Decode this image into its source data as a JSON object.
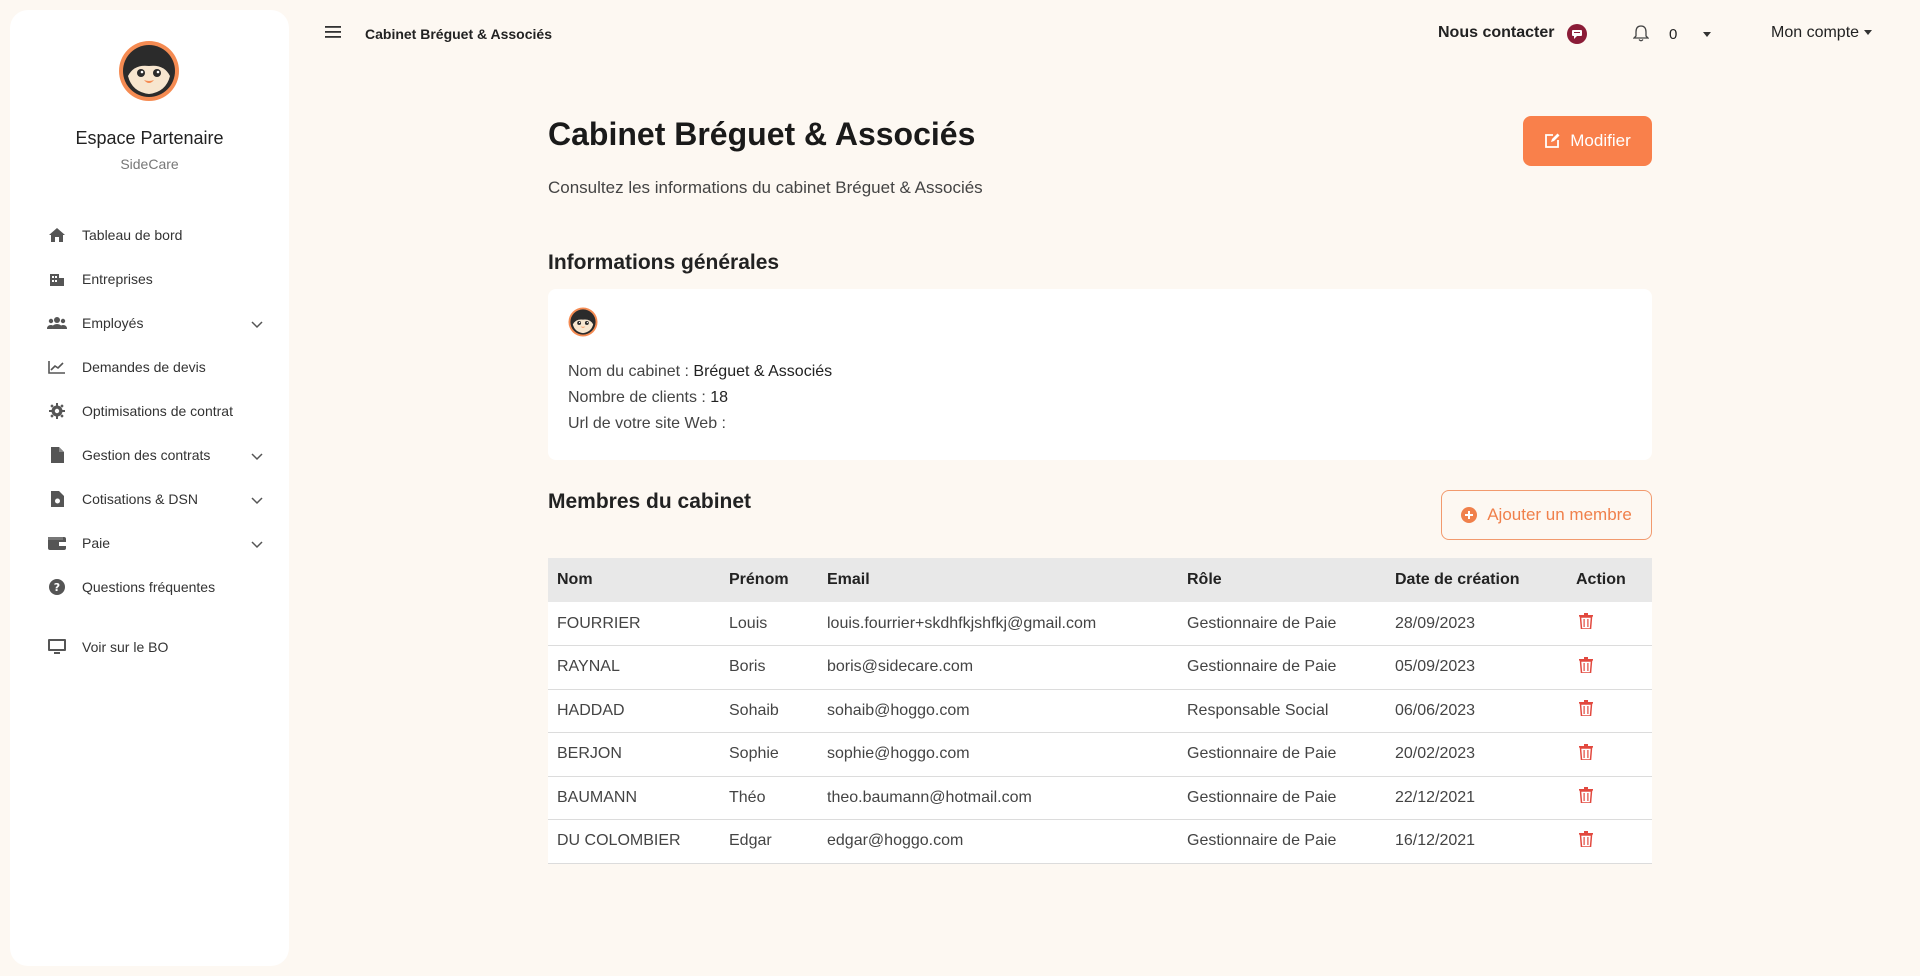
{
  "sidebar": {
    "brand_title": "Espace Partenaire",
    "brand_subtitle": "SideCare",
    "items": [
      {
        "label": "Tableau de bord",
        "icon": "home-icon"
      },
      {
        "label": "Entreprises",
        "icon": "building-icon"
      },
      {
        "label": "Employés",
        "icon": "users-icon",
        "expandable": true
      },
      {
        "label": "Demandes de devis",
        "icon": "chart-line-icon"
      },
      {
        "label": "Optimisations de contrat",
        "icon": "gear-icon"
      },
      {
        "label": "Gestion des contrats",
        "icon": "file-icon",
        "expandable": true
      },
      {
        "label": "Cotisations & DSN",
        "icon": "file-invoice-icon",
        "expandable": true
      },
      {
        "label": "Paie",
        "icon": "wallet-icon",
        "expandable": true
      },
      {
        "label": "Questions fréquentes",
        "icon": "question-circle-icon"
      },
      {
        "label": "Voir sur le BO",
        "icon": "desktop-icon"
      }
    ]
  },
  "topbar": {
    "breadcrumb": "Cabinet Bréguet & Associés",
    "contact_label": "Nous contacter",
    "notification_count": "0",
    "account_label": "Mon compte"
  },
  "main": {
    "title": "Cabinet Bréguet & Associés",
    "subtitle": "Consultez les informations du cabinet Bréguet & Associés",
    "edit_button": "Modifier",
    "general_section_title": "Informations générales",
    "info": {
      "name_label": "Nom du cabinet : ",
      "name_value": "Bréguet & Associés",
      "clients_label": "Nombre de clients : ",
      "clients_value": "18",
      "url_label": "Url de votre site Web : ",
      "url_value": ""
    },
    "members_section_title": "Membres du cabinet",
    "add_member_button": "Ajouter un membre",
    "table": {
      "headers": [
        "Nom",
        "Prénom",
        "Email",
        "Rôle",
        "Date de création",
        "Action"
      ],
      "rows": [
        {
          "nom": "FOURRIER",
          "prenom": "Louis",
          "email": "louis.fourrier+skdhfkjshfkj@gmail.com",
          "role": "Gestionnaire de Paie",
          "date": "28/09/2023"
        },
        {
          "nom": "RAYNAL",
          "prenom": "Boris",
          "email": "boris@sidecare.com",
          "role": "Gestionnaire de Paie",
          "date": "05/09/2023"
        },
        {
          "nom": "HADDAD",
          "prenom": "Sohaib",
          "email": "sohaib@hoggo.com",
          "role": "Responsable Social",
          "date": "06/06/2023"
        },
        {
          "nom": "BERJON",
          "prenom": "Sophie",
          "email": "sophie@hoggo.com",
          "role": "Gestionnaire de Paie",
          "date": "20/02/2023"
        },
        {
          "nom": "BAUMANN",
          "prenom": "Théo",
          "email": "theo.baumann@hotmail.com",
          "role": "Gestionnaire de Paie",
          "date": "22/12/2021"
        },
        {
          "nom": "DU COLOMBIER",
          "prenom": "Edgar",
          "email": "edgar@hoggo.com",
          "role": "Gestionnaire de Paie",
          "date": "16/12/2021"
        }
      ]
    }
  },
  "colors": {
    "accent": "#f9804b",
    "background": "#fdf8f2",
    "delete": "#e2493f",
    "contact_badge": "#8b1c37"
  }
}
